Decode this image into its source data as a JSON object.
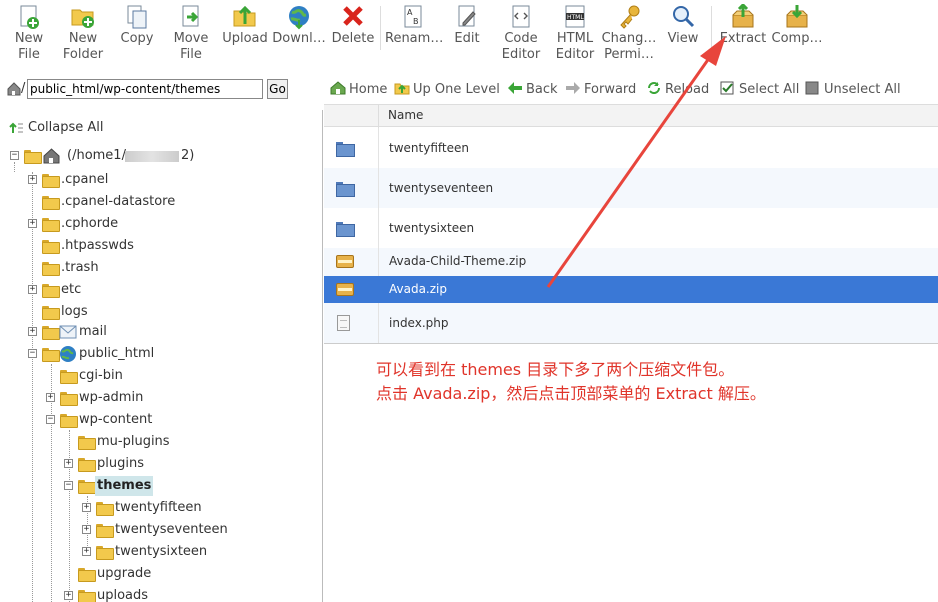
{
  "toolbar": {
    "buttons": [
      {
        "label1": "New",
        "label2": "File"
      },
      {
        "label1": "New",
        "label2": "Folder"
      },
      {
        "label1": "Copy",
        "label2": ""
      },
      {
        "label1": "Move",
        "label2": "File"
      },
      {
        "label1": "Upload",
        "label2": ""
      },
      {
        "label1": "Downl…",
        "label2": ""
      },
      {
        "label1": "Delete",
        "label2": ""
      },
      {
        "label1": "Renam…",
        "label2": ""
      },
      {
        "label1": "Edit",
        "label2": ""
      },
      {
        "label1": "Code",
        "label2": "Editor"
      },
      {
        "label1": "HTML",
        "label2": "Editor"
      },
      {
        "label1": "Chang…",
        "label2": "Permi…"
      },
      {
        "label1": "View",
        "label2": ""
      },
      {
        "label1": "Extract",
        "label2": ""
      },
      {
        "label1": "Comp…",
        "label2": ""
      }
    ],
    "html_icon_text": "HTML",
    "rename_icon_text": "A B"
  },
  "pathbar": {
    "slash": "/",
    "path_value": "public_html/wp-content/themes",
    "go_label": "Go"
  },
  "tree": {
    "collapse_all": "Collapse All",
    "root_label": "(/home1/",
    "root_suffix": "2)",
    "items": [
      ".cpanel",
      ".cpanel-datastore",
      ".cphorde",
      ".htpasswds",
      ".trash",
      "etc",
      "logs",
      "mail",
      "public_html",
      "cgi-bin",
      "wp-admin",
      "wp-content",
      "mu-plugins",
      "plugins",
      "themes",
      "twentyfifteen",
      "twentyseventeen",
      "twentysixteen",
      "upgrade",
      "uploads"
    ]
  },
  "navbar": {
    "home": "Home",
    "up_one_level": "Up One Level",
    "back": "Back",
    "forward": "Forward",
    "reload": "Reload",
    "select_all": "Select All",
    "unselect_all": "Unselect All"
  },
  "filetable": {
    "header_name": "Name",
    "files": [
      {
        "name": "twentyfifteen",
        "type": "folder"
      },
      {
        "name": "twentyseventeen",
        "type": "folder"
      },
      {
        "name": "twentysixteen",
        "type": "folder"
      },
      {
        "name": "Avada-Child-Theme.zip",
        "type": "zip"
      },
      {
        "name": "Avada.zip",
        "type": "zip",
        "selected": true
      },
      {
        "name": "index.php",
        "type": "doc"
      }
    ]
  },
  "annotation": {
    "line1": "可以看到在 themes 目录下多了两个压缩文件包。",
    "line2": "点击 Avada.zip，然后点击顶部菜单的 Extract 解压。"
  },
  "colors": {
    "selected_row": "#3a78d6",
    "annotation": "#e0342a",
    "arrow": "#e8453c"
  }
}
